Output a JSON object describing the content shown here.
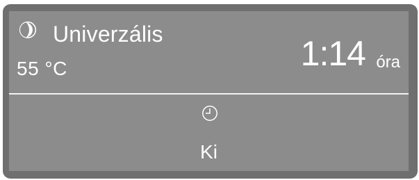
{
  "program": {
    "icon": "half-moon-program-icon",
    "name": "Univerzális",
    "temperature": "55 °C"
  },
  "duration": {
    "value": "1:14",
    "unit": "óra"
  },
  "timer": {
    "icon": "clock-timer-icon",
    "label": "Ki"
  },
  "colors": {
    "bezel": "#6f6f6f",
    "screen": "#8c8c8c",
    "text": "#ffffff"
  }
}
